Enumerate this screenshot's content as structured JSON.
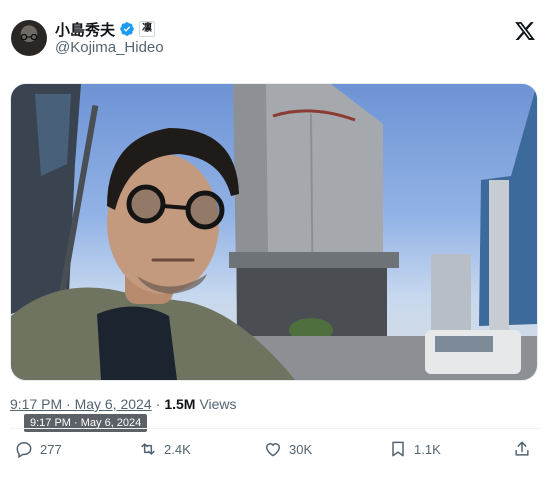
{
  "author": {
    "display_name": "小島秀夫",
    "handle": "@Kojima_Hideo",
    "affiliation_badge": "凛"
  },
  "icons": {
    "verified": "verified-badge-icon",
    "brand": "x-logo-icon",
    "reply": "reply-icon",
    "repost": "repost-icon",
    "like": "like-icon",
    "bookmark": "bookmark-icon",
    "share": "share-icon"
  },
  "colors": {
    "verified_blue": "#1d9bf0",
    "secondary_text": "#536471"
  },
  "post": {
    "timestamp": "9:17 PM · May 6, 2024",
    "separator": "·",
    "views_count": "1.5M",
    "views_label": "Views",
    "tooltip": "9:17 PM · May 6, 2024"
  },
  "actions": {
    "replies": "277",
    "reposts": "2.4K",
    "likes": "30K",
    "bookmarks": "1.1K"
  }
}
